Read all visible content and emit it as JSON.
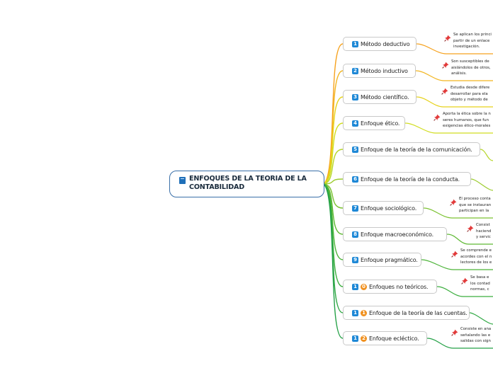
{
  "root": {
    "title": "ENFOQUES DE LA TEORIA DE LA\nCONTABILIDAD",
    "icon": "book-icon"
  },
  "branches": [
    {
      "badge": [
        "1"
      ],
      "label": "Método deductivo",
      "color": "#f6a21e",
      "note": [
        "Se aplican los princi",
        "partir de un enlace",
        "investigación."
      ]
    },
    {
      "badge": [
        "2"
      ],
      "label": "Método inductivo",
      "color": "#f2b51f",
      "note": [
        "Son susceptibles de",
        "aislándolos de otros,",
        "análisis."
      ]
    },
    {
      "badge": [
        "3"
      ],
      "label": "Método científico.",
      "color": "#e6d21a",
      "note": [
        "Estudia desde difere",
        "desarrollar para ela",
        "objeto y método de"
      ]
    },
    {
      "badge": [
        "4"
      ],
      "label": "Enfoque ético.",
      "color": "#d1dd21",
      "note": [
        "Aporta la ética sobre la n",
        "seres humanos, que fun",
        "exigencias ético-morales"
      ]
    },
    {
      "badge": [
        "5"
      ],
      "label": "Enfoque de la teoría de la comunicación.",
      "color": "#b6d62a",
      "note": []
    },
    {
      "badge": [
        "6"
      ],
      "label": "Enfoque de la teoría de la conducta.",
      "color": "#9ccc2f",
      "note": []
    },
    {
      "badge": [
        "7"
      ],
      "label": "Enfoque sociológico.",
      "color": "#7cc232",
      "note": [
        "El proceso conta",
        "que se instauran",
        "participan en la"
      ]
    },
    {
      "badge": [
        "8"
      ],
      "label": "Enfoque macroeconómico.",
      "color": "#5fb934",
      "note": [
        "Consist",
        "haciend",
        "y servic"
      ]
    },
    {
      "badge": [
        "9"
      ],
      "label": "Enfoque pragmático.",
      "color": "#4db439",
      "note": [
        "Se comprende e",
        "acordes con el n",
        "lectores de los e"
      ]
    },
    {
      "badge": [
        "1",
        "0"
      ],
      "label": "Enfoques no teóricos.",
      "color": "#3bae3e",
      "note": [
        "Se basa e",
        "los contad",
        "normas, c"
      ]
    },
    {
      "badge": [
        "1",
        "1"
      ],
      "label": "Enfoque de la teoría de las cuentas.",
      "color": "#2fa843",
      "note": []
    },
    {
      "badge": [
        "1",
        "2"
      ],
      "label": "Enfoque ecléctico.",
      "color": "#25a147",
      "note": [
        "Consiste en ana",
        "señalando las e",
        "salidas con sign"
      ]
    }
  ]
}
